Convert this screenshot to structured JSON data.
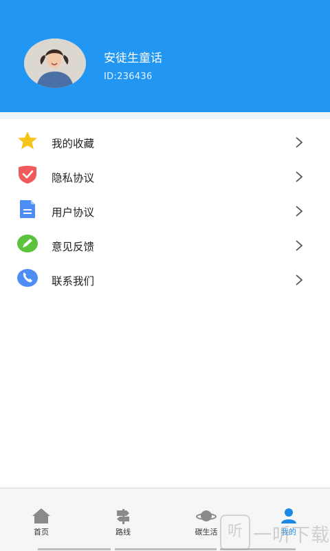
{
  "profile": {
    "name": "安徒生童话",
    "id_text": "ID:236436"
  },
  "menu": {
    "items": [
      {
        "label": "我的收藏",
        "icon": "star-icon"
      },
      {
        "label": "隐私协议",
        "icon": "shield-check-icon"
      },
      {
        "label": "用户协议",
        "icon": "document-icon"
      },
      {
        "label": "意见反馈",
        "icon": "pencil-icon"
      },
      {
        "label": "联系我们",
        "icon": "phone-icon"
      }
    ]
  },
  "tabbar": {
    "tabs": [
      {
        "label": "首页",
        "icon": "home-icon"
      },
      {
        "label": "路线",
        "icon": "signpost-icon"
      },
      {
        "label": "碳生活",
        "icon": "planet-icon"
      },
      {
        "label": "我的",
        "icon": "user-icon",
        "active": true
      }
    ]
  },
  "watermark": {
    "glyph": "听",
    "text": "一听下载"
  },
  "colors": {
    "header": "#2196f3",
    "active_tab": "#1e88e5",
    "star": "#f5c518",
    "shield": "#f05a5a",
    "document": "#4c8df6",
    "pencil": "#5cc43c",
    "phone": "#4c8df6"
  }
}
